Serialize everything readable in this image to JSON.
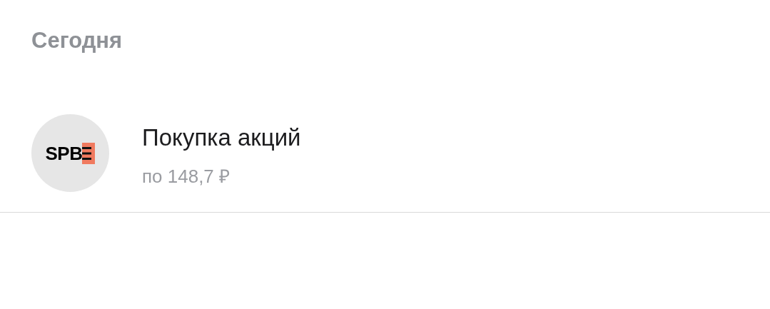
{
  "section_header": "Сегодня",
  "operations": [
    {
      "logo_text": "SPB",
      "title": "Покупка акций",
      "subtitle": "по 148,7 ₽"
    }
  ]
}
